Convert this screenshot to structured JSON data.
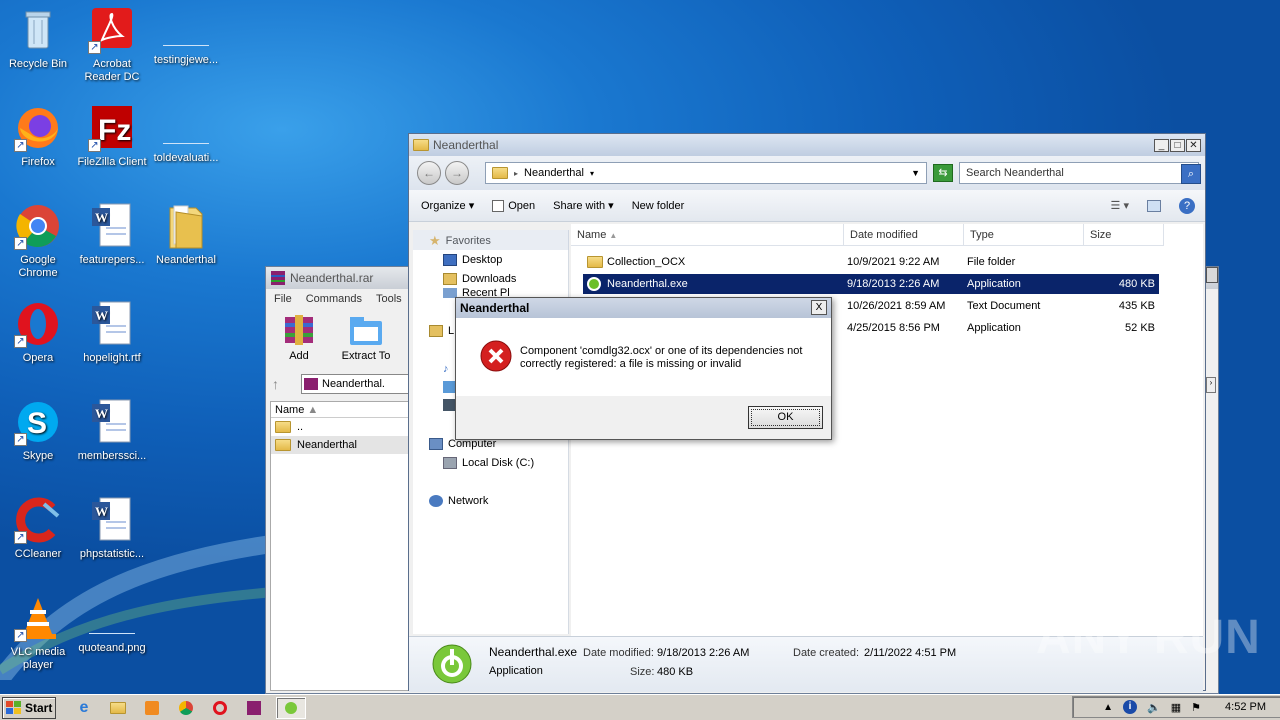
{
  "desktop": {
    "icons": [
      {
        "label": "Recycle Bin",
        "icon": "recycle-bin-icon"
      },
      {
        "label": "Acrobat Reader DC",
        "icon": "acrobat-icon"
      },
      {
        "label": "testingjewe...",
        "icon": "blank-file-icon"
      },
      {
        "label": "Firefox",
        "icon": "firefox-icon"
      },
      {
        "label": "FileZilla Client",
        "icon": "filezilla-icon"
      },
      {
        "label": "toldevaluati...",
        "icon": "blank-file-icon"
      },
      {
        "label": "Google Chrome",
        "icon": "chrome-icon"
      },
      {
        "label": "featurepers...",
        "icon": "word-doc-icon"
      },
      {
        "label": "Neanderthal",
        "icon": "folder-icon"
      },
      {
        "label": "Opera",
        "icon": "opera-icon"
      },
      {
        "label": "hopelight.rtf",
        "icon": "word-doc-icon"
      },
      {
        "label": "Skype",
        "icon": "skype-icon"
      },
      {
        "label": "memberssci...",
        "icon": "word-doc-icon"
      },
      {
        "label": "CCleaner",
        "icon": "ccleaner-icon"
      },
      {
        "label": "phpstatistic...",
        "icon": "word-doc-icon"
      },
      {
        "label": "VLC media player",
        "icon": "vlc-icon"
      },
      {
        "label": "quoteand.png",
        "icon": "blank-file-icon"
      }
    ]
  },
  "winrar": {
    "title": "Neanderthal.rar",
    "menu": [
      "File",
      "Commands",
      "Tools",
      "F"
    ],
    "tools": [
      "Add",
      "Extract To"
    ],
    "path": "Neanderthal.",
    "col_name": "Name",
    "items": [
      "..",
      "Neanderthal"
    ]
  },
  "explorer": {
    "title": "Neanderthal",
    "breadcrumb": "Neanderthal",
    "search_placeholder": "Search Neanderthal",
    "toolbar": {
      "organize": "Organize",
      "open": "Open",
      "share_with": "Share with",
      "new_folder": "New folder"
    },
    "nav": {
      "favorites": "Favorites",
      "desktop": "Desktop",
      "downloads": "Downloads",
      "recent_places": "Recent Pl",
      "libraries": "L",
      "computer": "Computer",
      "local_disk": "Local Disk (C:)",
      "network": "Network"
    },
    "columns": {
      "name": "Name",
      "date": "Date modified",
      "type": "Type",
      "size": "Size"
    },
    "files": [
      {
        "name": "Collection_OCX",
        "date": "10/9/2021 9:22 AM",
        "type": "File folder",
        "size": ""
      },
      {
        "name": "Neanderthal.exe",
        "date": "9/18/2013 2:26 AM",
        "type": "Application",
        "size": "480 KB"
      },
      {
        "name": "",
        "date": "10/26/2021 8:59 AM",
        "type": "Text Document",
        "size": "435 KB"
      },
      {
        "name": "",
        "date": "4/25/2015 8:56 PM",
        "type": "Application",
        "size": "52 KB"
      }
    ],
    "details": {
      "name": "Neanderthal.exe",
      "kind": "Application",
      "modified_label": "Date modified:",
      "modified": "9/18/2013 2:26 AM",
      "created_label": "Date created:",
      "created": "2/11/2022 4:51 PM",
      "size_label": "Size:",
      "size": "480 KB"
    }
  },
  "dialog": {
    "title": "Neanderthal",
    "message_line1": "Component 'comdlg32.ocx' or one of its dependencies not",
    "message_line2": "correctly registered: a file is missing or invalid",
    "ok": "OK",
    "close": "X"
  },
  "taskbar": {
    "start": "Start",
    "clock": "4:52 PM"
  },
  "watermark": "ANY RUN",
  "colors": {
    "selection": "#0a246a",
    "error": "#d42020",
    "desktop": "#1a78d0"
  }
}
